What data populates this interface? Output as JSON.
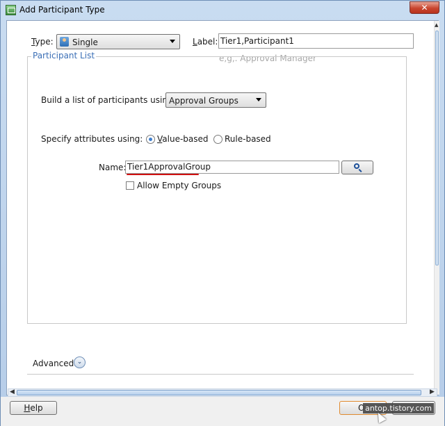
{
  "window": {
    "title": "Add Participant Type",
    "close_glyph": "✕"
  },
  "type_row": {
    "label": "Type:",
    "selected": "Single",
    "icon": "person-icon"
  },
  "label_row": {
    "label": "Label:",
    "value": "Tier1,Participant1",
    "hint": "e,g,. Approval Manager"
  },
  "participant_list": {
    "legend": "Participant List",
    "build_label": "Build a list of participants using:",
    "build_selected": "Approval Groups",
    "specify_label": "Specify attributes using:",
    "radio_value": "Value-based",
    "radio_rule": "Rule-based",
    "selected_option": "Value-based",
    "name_label": "Name:",
    "name_value": "Tier1ApprovalGroup",
    "search_icon": "search-icon",
    "allow_empty_label": "Allow Empty Groups",
    "allow_empty_checked": false
  },
  "advanced": {
    "label": "Advanced:",
    "icon": "chevron-double-down-icon"
  },
  "footer": {
    "help": "Help",
    "ok_partial": "O",
    "watermark": "antop.tistory.com"
  },
  "colors": {
    "accent": "#3b6fb6",
    "highlight": "#d01010",
    "close": "#c9462f"
  }
}
